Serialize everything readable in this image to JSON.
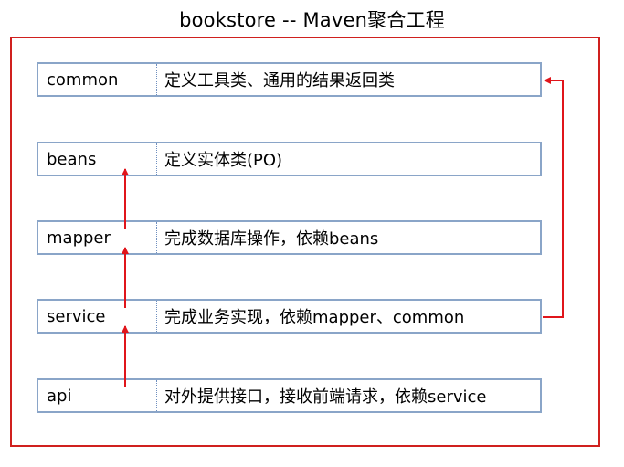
{
  "title": "bookstore  --  Maven聚合工程",
  "modules": [
    {
      "name": "common",
      "desc": "定义工具类、通用的结果返回类"
    },
    {
      "name": "beans",
      "desc": "定义实体类(PO)"
    },
    {
      "name": "mapper",
      "desc": "完成数据库操作，依赖beans"
    },
    {
      "name": "service",
      "desc": "完成业务实现，依赖mapper、common"
    },
    {
      "name": "api",
      "desc": "对外提供接口，接收前端请求，依赖service"
    }
  ],
  "colors": {
    "frame": "#d0201e",
    "box_border": "#8aa5c8",
    "arrow": "#e0151b"
  }
}
